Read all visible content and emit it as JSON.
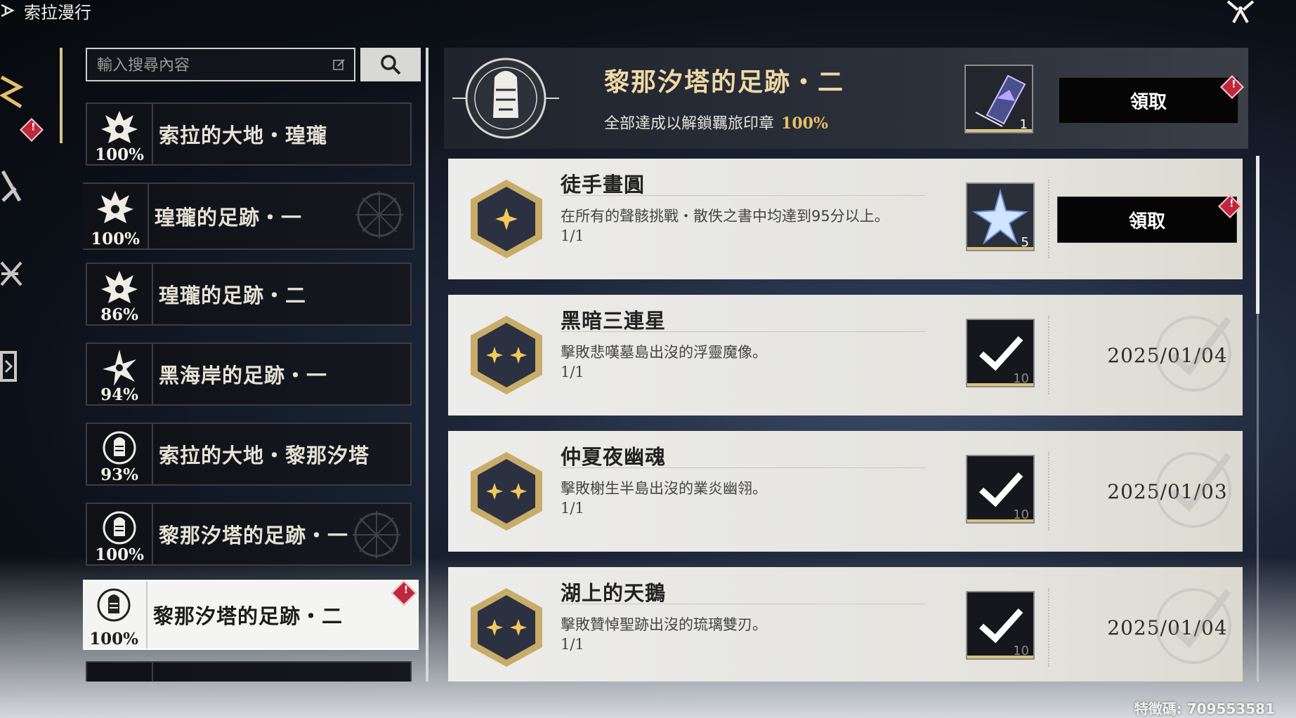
{
  "app": {
    "title": "索拉漫行"
  },
  "search": {
    "placeholder": "輸入搜尋內容"
  },
  "list": [
    {
      "name": "索拉的大地・瑝瓏",
      "pct": "100%"
    },
    {
      "name": "瑝瓏的足跡・一",
      "pct": "100%"
    },
    {
      "name": "瑝瓏的足跡・二",
      "pct": "86%"
    },
    {
      "name": "黑海岸的足跡・一",
      "pct": "94%"
    },
    {
      "name": "索拉的大地・黎那汐塔",
      "pct": "93%"
    },
    {
      "name": "黎那汐塔的足跡・一",
      "pct": "100%"
    },
    {
      "name": "黎那汐塔的足跡・二",
      "pct": "100%"
    }
  ],
  "header": {
    "title": "黎那汐塔的足跡・二",
    "subtitle": "全部達成以解鎖羈旅印章",
    "percent": "100%",
    "reward_count": "1",
    "claim_label": "領取"
  },
  "achievements": [
    {
      "title": "徒手畫圓",
      "desc": "在所有的聲骸挑戰・散佚之書中均達到95分以上。",
      "progress": "1/1",
      "reward_count": "5",
      "claim_label": "領取",
      "stars": 1
    },
    {
      "title": "黑暗三連星",
      "desc": "擊敗悲嘆墓島出沒的浮靈魔像。",
      "progress": "1/1",
      "reward_count": "10",
      "date": "2025/01/04",
      "stars": 2
    },
    {
      "title": "仲夏夜幽魂",
      "desc": "擊敗榭生半島出沒的業炎幽翎。",
      "progress": "1/1",
      "reward_count": "10",
      "date": "2025/01/03",
      "stars": 2
    },
    {
      "title": "湖上的天鵝",
      "desc": "擊敗贊悼聖跡出沒的琉璃雙刃。",
      "progress": "1/1",
      "reward_count": "10",
      "date": "2025/01/04",
      "stars": 2
    }
  ],
  "footer": {
    "feature_code": "特徵碼: 709553581"
  },
  "colors": {
    "accent_gold": "#e4bf6a",
    "badge_red": "#c0263c",
    "title_gold": "#efd9a6"
  },
  "icons": [
    "app-logo-icon",
    "close-x-icon",
    "search-icon",
    "edit-icon",
    "dragon-emblem-icon",
    "star-flower-emblem-icon",
    "seal-emblem-icon",
    "check-icon",
    "star-crystal-icon",
    "card-item-icon"
  ]
}
